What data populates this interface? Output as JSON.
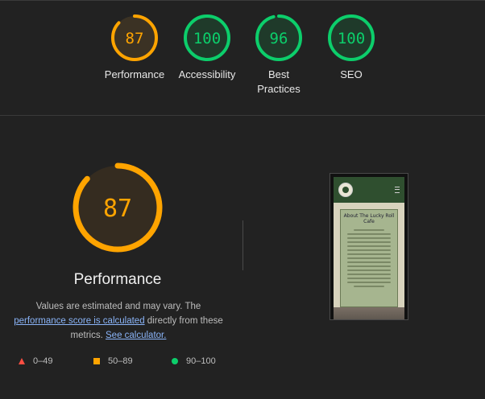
{
  "summary": {
    "gauges": [
      {
        "score": "87",
        "label": "Performance",
        "color": "#ffa400",
        "fraction": 0.87
      },
      {
        "score": "100",
        "label": "Accessibility",
        "color": "#0cce6b",
        "fraction": 1.0
      },
      {
        "score": "96",
        "label": "Best Practices",
        "color": "#0cce6b",
        "fraction": 0.96
      },
      {
        "score": "100",
        "label": "SEO",
        "color": "#0cce6b",
        "fraction": 1.0
      }
    ]
  },
  "performance": {
    "score": "87",
    "fraction": 0.87,
    "color": "#ffa400",
    "title": "Performance",
    "desc_prefix": "Values are estimated and may vary. The ",
    "link1": "performance score is calculated",
    "desc_middle": " directly from these metrics. ",
    "link2": "See calculator."
  },
  "legend": [
    {
      "range": "0–49",
      "shape": "triangle",
      "color": "#ff4e42"
    },
    {
      "range": "50–89",
      "shape": "square",
      "color": "#ffa400"
    },
    {
      "range": "90–100",
      "shape": "circle",
      "color": "#0cce6b"
    }
  ],
  "preview": {
    "card_title": "About The Lucky Roll Cafe"
  }
}
